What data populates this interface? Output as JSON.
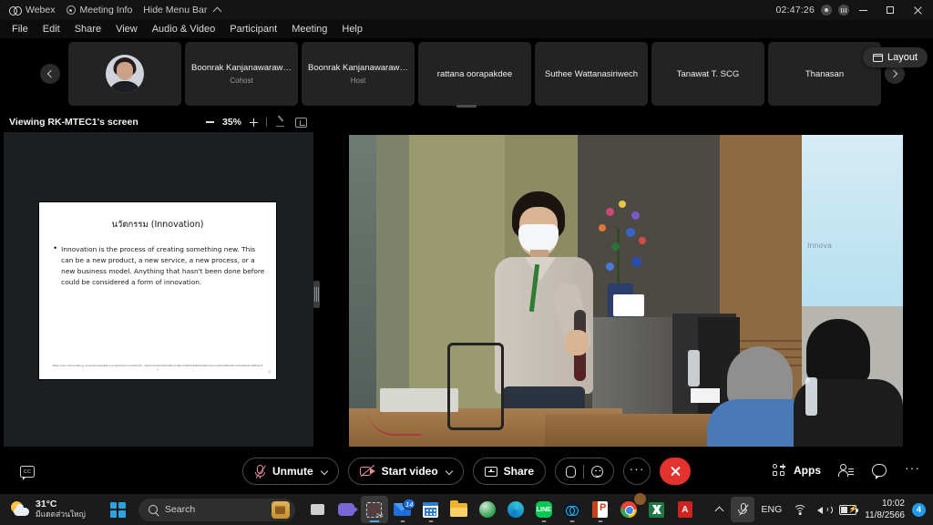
{
  "titlebar": {
    "app_name": "Webex",
    "meeting_info": "Meeting Info",
    "hide_menu_bar": "Hide Menu Bar",
    "timer": "02:47:26",
    "record_icon": "record-icon",
    "network_icon": "network-quality-icon",
    "minimize": "minimize-button",
    "maximize": "maximize-button",
    "close": "close-button"
  },
  "menubar": {
    "items": [
      {
        "label": "File"
      },
      {
        "label": "Edit"
      },
      {
        "label": "Share"
      },
      {
        "label": "View"
      },
      {
        "label": "Audio & Video"
      },
      {
        "label": "Participant"
      },
      {
        "label": "Meeting"
      },
      {
        "label": "Help"
      }
    ]
  },
  "filmstrip": {
    "prev_label": "previous-participants",
    "next_label": "next-participants",
    "layout_button": "Layout",
    "tiles": [
      {
        "name": "",
        "role": "",
        "has_avatar": true
      },
      {
        "name": "Boonrak Kanjanawarawa...",
        "role": "Cohost",
        "has_avatar": false
      },
      {
        "name": "Boonrak Kanjanawarawa...",
        "role": "Host",
        "has_avatar": false
      },
      {
        "name": "rattana oorapakdee",
        "role": "",
        "has_avatar": false
      },
      {
        "name": "Suthee Wattanasiriwech",
        "role": "",
        "has_avatar": false
      },
      {
        "name": "Tanawat T. SCG",
        "role": "",
        "has_avatar": false
      },
      {
        "name": "Thanasan",
        "role": "",
        "has_avatar": false
      }
    ]
  },
  "share_panel": {
    "viewing_label": "Viewing RK-MTEC1's screen",
    "zoom_out": "zoom-out",
    "zoom_level": "35%",
    "zoom_in": "zoom-in",
    "annotate_icon": "annotate-icon",
    "popout_icon": "pop-out-icon",
    "slide": {
      "title": "นวัตกรรม (Innovation)",
      "bullet": "•",
      "body": "Innovation is the process of creating something new. This can be a new product, a new service, a new process, or a new business model. Anything that hasn't been done before could be considered a form of innovation.",
      "footer": "https://uab.com/en/able-gy-and-planning/what-is-incremental-innovation/#:~:text=Incremental%20Innovation%20is%20the%20process.make%20it%20more%20user%20friendly",
      "page_number": "5"
    }
  },
  "video": {
    "projector_text": "Innova",
    "scene_label": "presenter-with-microphone"
  },
  "controls": {
    "closed_caption": "CC",
    "mute_button": "Unmute",
    "video_button": "Start video",
    "share_button": "Share",
    "reactions_icon": "raise-hand-icon",
    "emoji_icon": "reactions-icon",
    "more_options": "···",
    "end_meeting": "end-meeting",
    "apps_button": "Apps",
    "participants_icon": "participants-icon",
    "chat_icon": "chat-icon",
    "more_icon": "···"
  },
  "taskbar": {
    "weather_temp": "31°C",
    "weather_desc": "มีแดดส่วนใหญ่",
    "start_label": "start-button",
    "search_placeholder": "Search",
    "apps": [
      {
        "name": "task-view"
      },
      {
        "name": "meet-now"
      },
      {
        "name": "snipping-tool",
        "active": true
      },
      {
        "name": "mail",
        "badge": "14"
      },
      {
        "name": "calendar"
      },
      {
        "name": "file-explorer"
      },
      {
        "name": "browser-green"
      },
      {
        "name": "microsoft-edge"
      },
      {
        "name": "line"
      },
      {
        "name": "webex"
      },
      {
        "name": "powerpoint"
      },
      {
        "name": "google-chrome"
      },
      {
        "name": "excel"
      },
      {
        "name": "adobe-acrobat"
      }
    ],
    "tray": {
      "overflow": "show-hidden-icons",
      "mic_muted": "microphone-muted-icon",
      "language": "ENG",
      "wifi": "wifi-icon",
      "volume": "volume-icon",
      "battery": "battery-charging-icon",
      "time": "10:02",
      "date": "11/8/2566",
      "notification_count": "4"
    }
  },
  "colors": {
    "accent_red": "#e4332e",
    "mute_pink": "#e98f9d",
    "taskbar_bg": "#1b1b1b",
    "notif_blue": "#1f9cf0"
  }
}
